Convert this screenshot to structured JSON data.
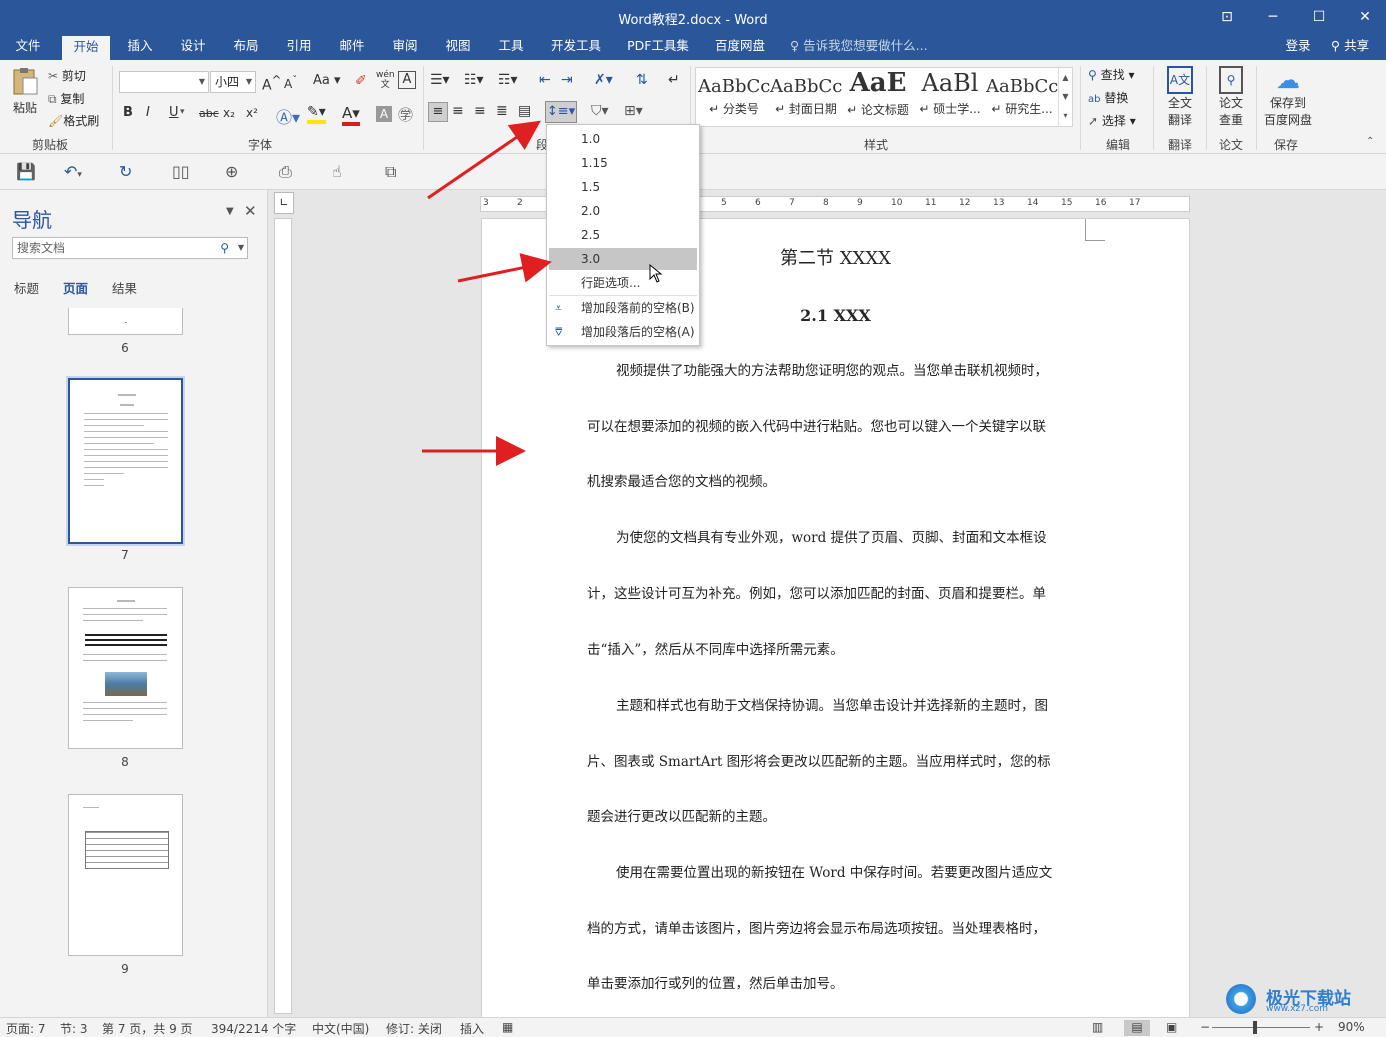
{
  "window": {
    "title": "Word教程2.docx - Word",
    "controls": [
      "⊡",
      "─",
      "☐",
      "✕"
    ]
  },
  "ribbon_tabs": [
    "文件",
    "开始",
    "插入",
    "设计",
    "布局",
    "引用",
    "邮件",
    "审阅",
    "视图",
    "工具",
    "开发工具",
    "PDF工具集",
    "百度网盘"
  ],
  "active_tab": "开始",
  "tell_me": "告诉我您想要做什么...",
  "account": {
    "login": "登录",
    "share": "共享"
  },
  "clipboard": {
    "paste": "粘贴",
    "cut": "剪切",
    "copy": "复制",
    "format_painter": "格式刷",
    "group": "剪贴板"
  },
  "font": {
    "font_name": "",
    "font_size": "小四",
    "group": "字体",
    "case_label": "Aa",
    "pinyin": "wén",
    "bold": "B",
    "italic": "I",
    "underline": "U",
    "strike": "abc",
    "sub": "x₂",
    "sup": "x²",
    "grow": "A",
    "shrink": "A",
    "color_a": "A"
  },
  "paragraph": {
    "group": "段"
  },
  "styles": {
    "group": "样式",
    "items": [
      {
        "preview": "AaBbCc",
        "name": "↵ 分类号"
      },
      {
        "preview": "AaBbCc",
        "name": "↵ 封面日期"
      },
      {
        "preview": "AaE",
        "name": "↵ 论文标题"
      },
      {
        "preview": "AaBl",
        "name": "↵ 硕士学..."
      },
      {
        "preview": "AaBbCc",
        "name": "↵ 研究生..."
      }
    ]
  },
  "editing": {
    "find": "查找",
    "replace": "替换",
    "select": "选择",
    "group": "编辑"
  },
  "translate": {
    "label1": "全文",
    "label2": "翻译",
    "group": "翻译"
  },
  "paper": {
    "label1": "论文",
    "label2": "查重",
    "group": "论文"
  },
  "save_cloud": {
    "label1": "保存到",
    "label2": "百度网盘",
    "group": "保存"
  },
  "nav": {
    "title": "导航",
    "search_placeholder": "搜索文档",
    "tabs": [
      "标题",
      "页面",
      "结果"
    ],
    "active_tab": "页面",
    "pages": [
      "6",
      "7",
      "8",
      "9"
    ],
    "selected_page": "7"
  },
  "line_spacing_menu": {
    "options": [
      "1.0",
      "1.15",
      "1.5",
      "2.0",
      "2.5",
      "3.0"
    ],
    "selected": "3.0",
    "more": "行距选项...",
    "add_before": "增加段落前的空格(B)",
    "add_after": "增加段落后的空格(A)"
  },
  "document": {
    "heading1": "第二节  XXXX",
    "heading2": "2.1 XXX",
    "lines": [
      "视频提供了功能强大的方法帮助您证明您的观点。当您单击联机视频时，",
      "可以在想要添加的视频的嵌入代码中进行粘贴。您也可以键入一个关键字以联",
      "机搜索最适合您的文档的视频。",
      "为使您的文档具有专业外观，word 提供了页眉、页脚、封面和文本框设",
      "计，这些设计可互为补充。例如，您可以添加匹配的封面、页眉和提要栏。单",
      "击“插入”，然后从不同库中选择所需元素。",
      "主题和样式也有助于文档保持协调。当您单击设计并选择新的主题时，图",
      "片、图表或 SmartArt 图形将会更改以匹配新的主题。当应用样式时，您的标",
      "题会进行更改以匹配新的主题。",
      "使用在需要位置出现的新按钮在 Word 中保存时间。若要更改图片适应文",
      "档的方式，请单击该图片，图片旁边将会显示布局选项按钮。当处理表格时，",
      "单击要添加行或列的位置，然后单击加号。"
    ]
  },
  "ruler": {
    "h_ticks": [
      "3",
      "2",
      "1",
      "1",
      "2",
      "3",
      "4",
      "5",
      "6",
      "7",
      "8",
      "9",
      "10",
      "11",
      "12",
      "13",
      "14",
      "15",
      "16",
      "17"
    ]
  },
  "status": {
    "page": "页面: 7",
    "section": "节: 3",
    "page_of": "第 7 页，共 9 页",
    "words": "394/2214 个字",
    "lang": "中文(中国)",
    "track": "修订: 关闭",
    "insert": "插入",
    "zoom": "90%"
  },
  "watermark": "极光下载站",
  "watermark_url": "www.xz7.com",
  "accent": "#2b579a",
  "arrow_color": "#e02020"
}
